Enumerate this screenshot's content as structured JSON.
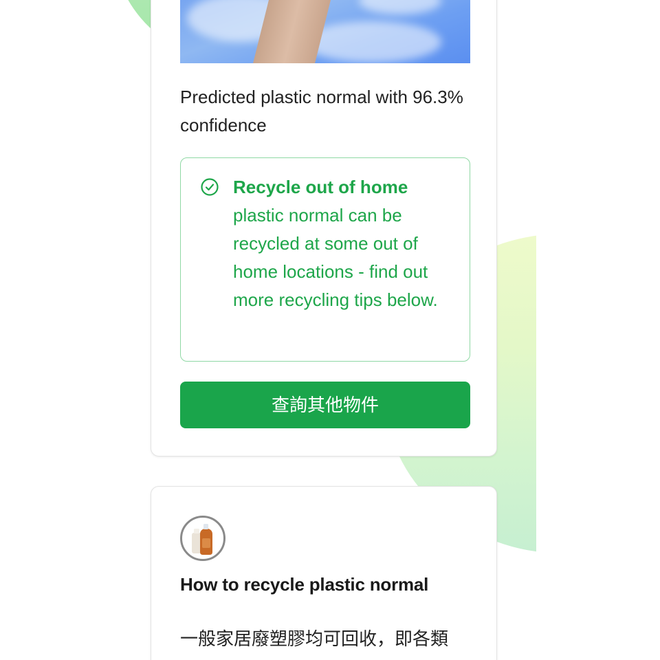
{
  "result_card": {
    "prediction_text": "Predicted plastic normal with 96.3% confidence",
    "notice": {
      "title": "Recycle out of home",
      "body": "plastic normal can be recycled at some out of home locations - find out more recycling tips below."
    },
    "query_button_label": "查詢其他物件"
  },
  "recycle_card": {
    "title": "How to recycle plastic normal",
    "body": "一般家居廢塑膠均可回收，即各類"
  },
  "colors": {
    "accent_green": "#1aa54b",
    "notice_border": "#8fd8a4",
    "notice_text": "#1ea64a"
  },
  "icons": {
    "notice": "check-circle-icon",
    "category": "plastic-bottle-icon"
  }
}
